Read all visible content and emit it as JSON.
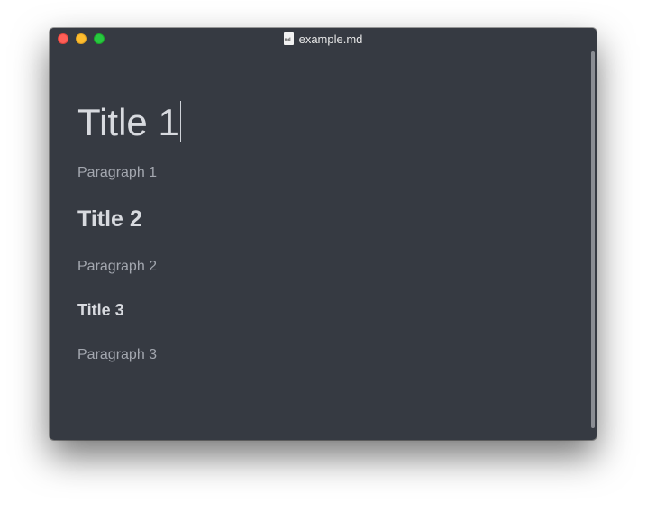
{
  "window": {
    "title": "example.md",
    "file_icon": "markdown-file-icon"
  },
  "document": {
    "title1": "Title 1",
    "paragraph1": "Paragraph 1",
    "title2": "Title 2",
    "paragraph2": "Paragraph 2",
    "title3": "Title 3",
    "paragraph3": "Paragraph 3"
  },
  "colors": {
    "background": "#363a42",
    "heading_text": "#d8dadf",
    "paragraph_text": "#a3a7af",
    "close": "#ff5f57",
    "minimize": "#febc2e",
    "zoom": "#28c840"
  }
}
